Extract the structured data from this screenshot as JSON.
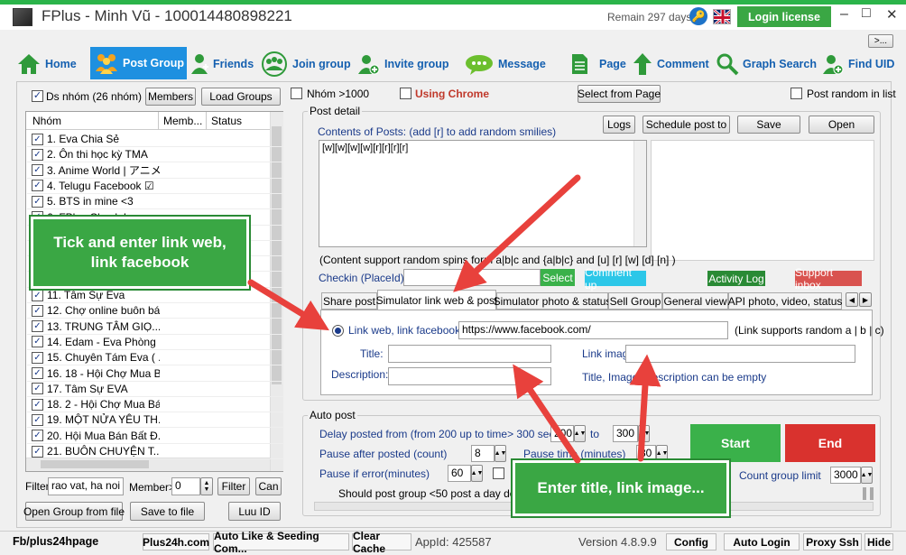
{
  "window": {
    "title": "FPlus - Minh Vũ - 100014480898221",
    "remain": "Remain 297 days",
    "login_license": "Login license",
    "minimize": "–",
    "maximize": "□",
    "close": "✕",
    "more": ">..."
  },
  "nav": [
    {
      "label": "Home",
      "icon": "home-icon"
    },
    {
      "label": "Post Group",
      "icon": "group-icon"
    },
    {
      "label": "Friends",
      "icon": "friends-icon"
    },
    {
      "label": "Join group",
      "icon": "join-group-icon"
    },
    {
      "label": "Invite group",
      "icon": "invite-group-icon"
    },
    {
      "label": "Message",
      "icon": "message-icon"
    },
    {
      "label": "Page",
      "icon": "page-icon"
    },
    {
      "label": "Comment",
      "icon": "comment-icon"
    },
    {
      "label": "Graph Search",
      "icon": "search-icon"
    },
    {
      "label": "Find UID",
      "icon": "find-uid-icon"
    }
  ],
  "left": {
    "ds_nhom": "Ds nhóm (26 nhóm)",
    "members_btn": "Members",
    "load_groups_btn": "Load Groups",
    "col_nhom": "Nhóm",
    "col_member": "Memb...",
    "col_status": "Status",
    "groups": [
      "1. Eva Chia Sẻ",
      "2. Ôn thi học kỳ TMA",
      "3. Anime World | アニメ...",
      "4. Telugu Facebook ☑",
      "5. BTS in mine <3",
      "6. FPlus Check I...",
      "",
      "",
      "",
      "",
      "11. Tâm Sự Eva",
      "12. Chợ online buôn bá...",
      "13. TRUNG TÂM GIỌ...",
      "14. Edam - Eva Phòng ...",
      "15. Chuyên Tám Eva ( ...",
      "16. 18 - Hội Chợ Mua B...",
      "17. Tâm Sự EVA",
      "18. 2 - Hội Chợ Mua Bá...",
      "19. MỘT NỬA YÊU TH...",
      "20. Hội Mua Bán Bất Đ...",
      "21. BUÔN CHUYỆN T..."
    ],
    "filter_label": "Filter",
    "filter_value": "rao vat, ha noi",
    "member_gt": "Member>",
    "member_value": "0",
    "filter_btn": "Filter",
    "can_btn": "Can",
    "open_group_btn": "Open Group from file",
    "save_file_btn": "Save to file",
    "luu_id_btn": "Luu ID"
  },
  "options": {
    "nhom_1000": "Nhóm >1000",
    "using_chrome": "Using Chrome",
    "select_from_page": "Select from Page",
    "post_random": "Post random in list"
  },
  "post_detail": {
    "group_title": "Post detail",
    "contents_label": "Contents of Posts: (add [r] to add random smilies)",
    "logs_btn": "Logs",
    "schedule_btn": "Schedule post to",
    "save_btn": "Save",
    "open_btn": "Open",
    "content": "[w][w][w][w][r][r][r][r]",
    "spin_note": "(Content support random spins form a|b|c and {a|b|c} and [u] [r] [w] [d] [n] )",
    "checkin_label": "Checkin (PlaceId):",
    "select_btn": "Select",
    "comment_up": "Comment up",
    "activity_log": "Activity Log",
    "support_inbox": "Support inbox"
  },
  "tabs": [
    "Share post",
    "Simulator link web & post",
    "Simulator photo & status",
    "Sell Group",
    "General view",
    "API photo, video, status"
  ],
  "sim": {
    "link_label": "Link web, link facebook",
    "link_value": "https://www.facebook.com/",
    "link_note": "(Link supports random a | b | c)",
    "title_label": "Title:",
    "link_image_label": "Link image",
    "description_label": "Description:",
    "empty_note": "Title, Image, Description can be empty"
  },
  "autopost": {
    "group_title": "Auto post",
    "delay_label": "Delay posted from (from 200 up to time> 300 seconds)",
    "delay_from": "200",
    "to_label": "to",
    "delay_to": "300",
    "pause_after_label": "Pause after posted (count)",
    "pause_after_value": "8",
    "pause_time_label": "Pause time (minutes)",
    "pause_time_value": "30",
    "pause_error_label": "Pause if error(minutes)",
    "pause_error_value": "60",
    "count_group_label": "Count group limit",
    "count_group_value": "3000",
    "note": "Should post group <50 post a day delays",
    "start_btn": "Start",
    "end_btn": "End"
  },
  "callouts": {
    "left": "Tick and enter link web, link facebook",
    "bottom": "Enter title, link image..."
  },
  "status": {
    "left": "Fb/plus24hpage",
    "items": [
      "Plus24h.com",
      "Auto Like & Seeding Com...",
      "Clear Cache"
    ],
    "appid": "AppId: 425587",
    "version": "Version 4.8.9.9",
    "right": [
      "Config",
      "Auto Login",
      "Proxy Ssh",
      "Hide"
    ]
  },
  "colors": {
    "accent_green": "#2bb44a",
    "nav_blue": "#1560b0",
    "start_green": "#3ab14a",
    "end_red": "#d9322e",
    "arrow_red": "#e8413c"
  }
}
